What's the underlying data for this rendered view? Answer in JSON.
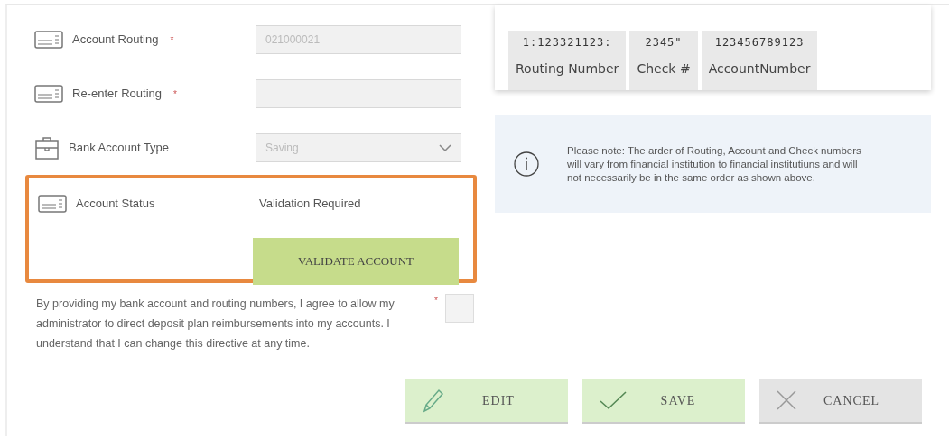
{
  "fields": [
    {
      "kind": "input",
      "label": "Account Routing",
      "required_mark": "*",
      "value": "021000021",
      "disabled": true
    },
    {
      "kind": "input",
      "label": "Re-enter Routing",
      "required_mark": "*",
      "disabled": true
    },
    {
      "kind": "select",
      "label": "Bank Account Type",
      "value": "Saving",
      "disabled": true
    }
  ],
  "status": {
    "label": "Account Status",
    "value": "Validation Required",
    "button": "VALIDATE ACCOUNT",
    "highlighted": true
  },
  "consent": {
    "text": "By providing my bank account and routing numbers, I agree to allow my administrator to direct deposit plan reimbursements into my accounts. I understand that I can change this directive at any time.",
    "required_mark": "*",
    "checked": false
  },
  "check_diagram": [
    {
      "digits": "1:123321123:",
      "label": "Routing Number"
    },
    {
      "digits": "2345\"",
      "label": "Check #"
    },
    {
      "digits": "123456789123",
      "label": "AccountNumber"
    }
  ],
  "note": "Please note: The arder of Routing, Account and Check numbers will vary from financial institution to financial institutiuns and will not necessarily be in the same order as shown above.",
  "buttons": [
    {
      "kind": "edit",
      "label": "EDIT"
    },
    {
      "kind": "save",
      "label": "SAVE"
    },
    {
      "kind": "cancel",
      "label": "CANCEL"
    }
  ]
}
